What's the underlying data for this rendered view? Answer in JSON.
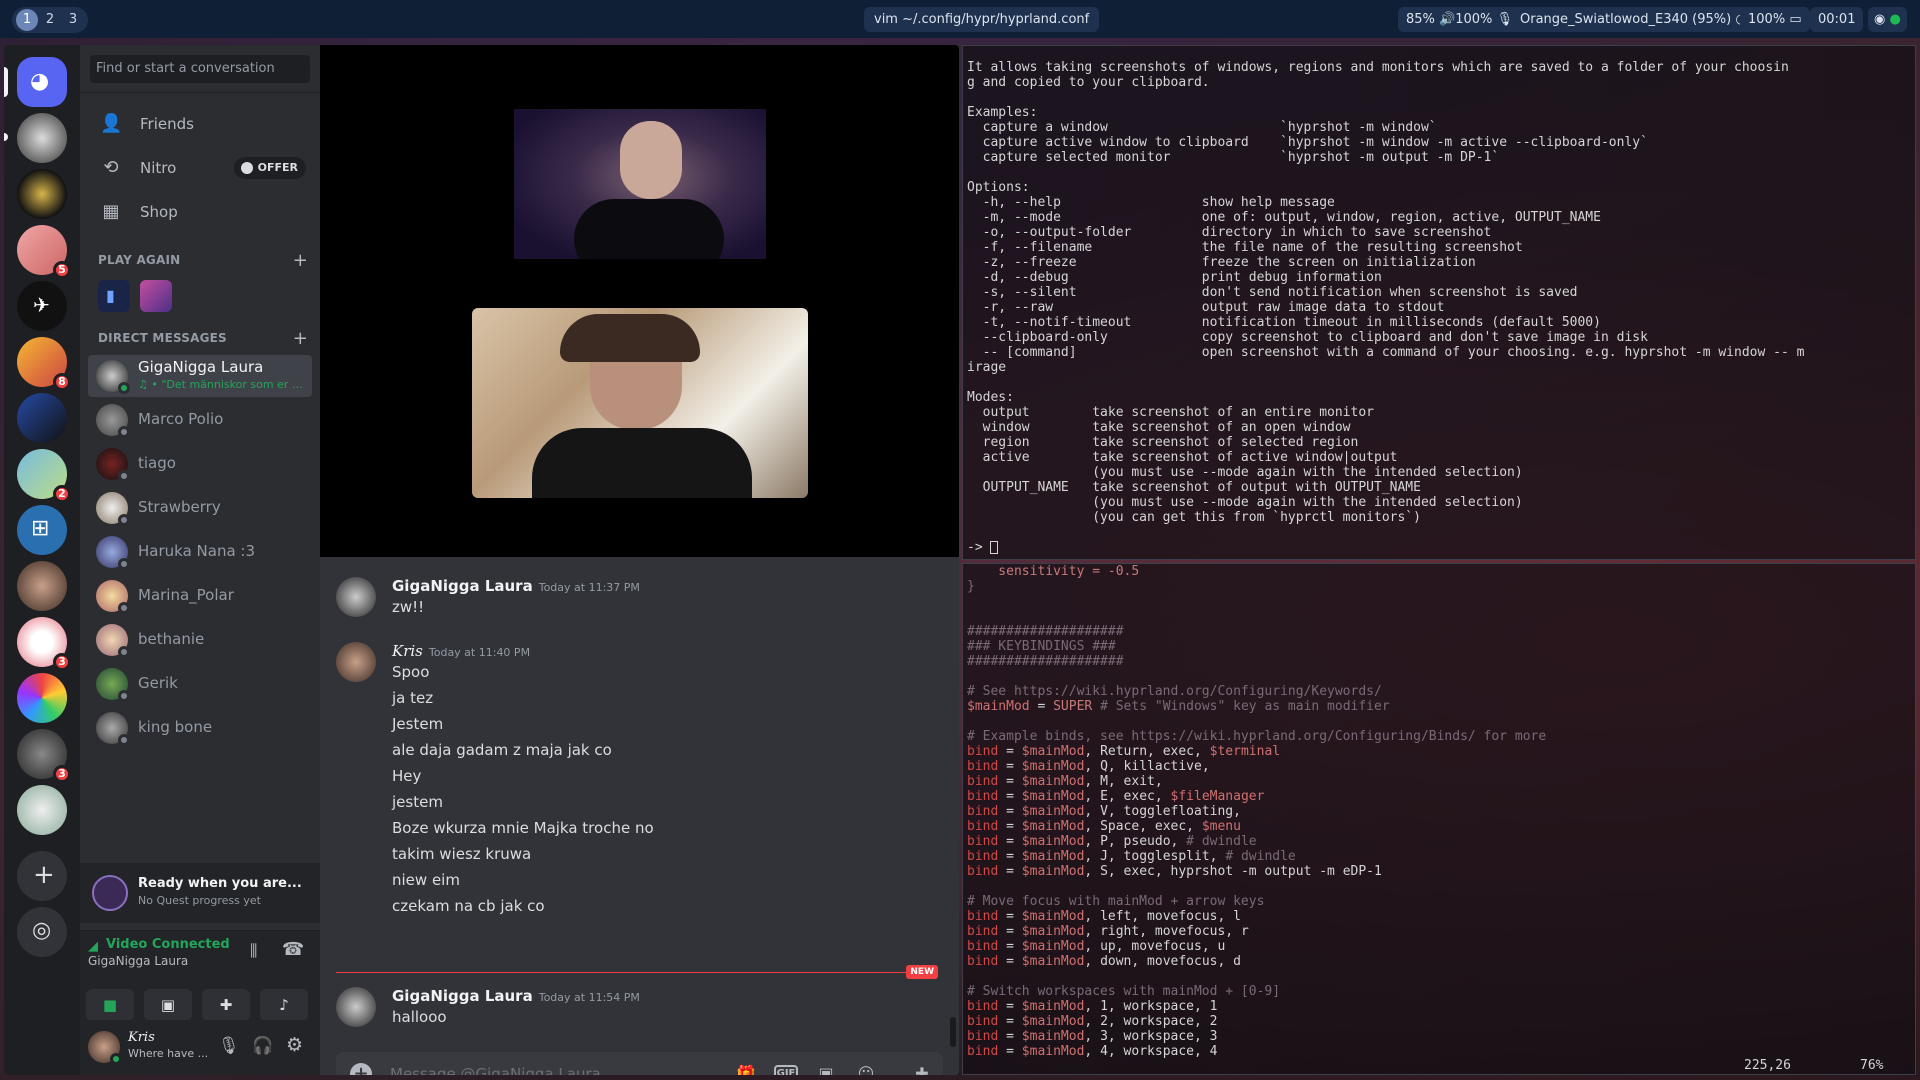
{
  "topbar": {
    "workspaces": [
      "1",
      "2",
      "3"
    ],
    "window_title": "vim ~/.config/hypr/hyprland.conf",
    "brightness": "85%",
    "volume": "100%",
    "wifi": "Orange_Swiatlowod_E340 (95%)",
    "battery": "100%",
    "clock": "00:01"
  },
  "discord": {
    "search_placeholder": "Find or start a conversation",
    "nav": {
      "friends": "Friends",
      "nitro": "Nitro",
      "nitro_offer": "OFFER",
      "shop": "Shop"
    },
    "play_again_header": "PLAY AGAIN",
    "dm_header": "DIRECT MESSAGES",
    "server_badges": [
      "5",
      "8",
      "2",
      "3",
      "3"
    ],
    "dms": [
      {
        "name": "GigaNigga Laura",
        "sub": "♫ • \"Det människor som er so..."
      },
      {
        "name": "Marco Polio"
      },
      {
        "name": "tiago"
      },
      {
        "name": "Strawberry"
      },
      {
        "name": "Haruka Nana :3"
      },
      {
        "name": "Marina_Polar"
      },
      {
        "name": "bethanie"
      },
      {
        "name": "Gerik"
      },
      {
        "name": "king bone"
      }
    ],
    "quest": {
      "title": "Ready when you are...",
      "sub": "No Quest progress yet"
    },
    "voice": {
      "status": "Video Connected",
      "channel": "GigaNigga Laura"
    },
    "user": {
      "name": "Kris",
      "status": "Where have ..."
    },
    "messages": [
      {
        "author": "GigaNigga Laura",
        "time": "Today at 11:37 PM",
        "lines": [
          "zw!!"
        ]
      },
      {
        "author": "Kris",
        "time": "Today at 11:40 PM",
        "lines": [
          "Spoo",
          "ja tez",
          "Jestem",
          "ale daja gadam z maja jak co",
          "Hey",
          "jestem",
          "Boze wkurza mnie Majka troche no",
          "takim wiesz kruwa",
          "niew eim",
          "czekam na cb jak co"
        ]
      },
      {
        "author": "GigaNigga Laura",
        "time": "Today at 11:54 PM",
        "lines": [
          "hallooo"
        ]
      }
    ],
    "new_label": "NEW",
    "composer_placeholder": "Message @GigaNigga Laura",
    "composer_gif": "GIF"
  },
  "term1": {
    "lines": [
      "It allows taking screenshots of windows, regions and monitors which are saved to a folder of your choosin",
      "g and copied to your clipboard.",
      "",
      "Examples:",
      "  capture a window                      `hyprshot -m window`",
      "  capture active window to clipboard    `hyprshot -m window -m active --clipboard-only`",
      "  capture selected monitor              `hyprshot -m output -m DP-1`",
      "",
      "Options:",
      "  -h, --help                  show help message",
      "  -m, --mode                  one of: output, window, region, active, OUTPUT_NAME",
      "  -o, --output-folder         directory in which to save screenshot",
      "  -f, --filename              the file name of the resulting screenshot",
      "  -z, --freeze                freeze the screen on initialization",
      "  -d, --debug                 print debug information",
      "  -s, --silent                don't send notification when screenshot is saved",
      "  -r, --raw                   output raw image data to stdout",
      "  -t, --notif-timeout         notification timeout in milliseconds (default 5000)",
      "  --clipboard-only            copy screenshot to clipboard and don't save image in disk",
      "  -- [command]                open screenshot with a command of your choosing. e.g. hyprshot -m window -- m",
      "irage",
      "",
      "Modes:",
      "  output        take screenshot of an entire monitor",
      "  window        take screenshot of an open window",
      "  region        take screenshot of selected region",
      "  active        take screenshot of active window|output",
      "                (you must use --mode again with the intended selection)",
      "  OUTPUT_NAME   take screenshot of output with OUTPUT_NAME",
      "                (you must use --mode again with the intended selection)",
      "                (you can get this from `hyprctl monitors`)",
      "",
      "-> "
    ]
  },
  "term2": {
    "lines": [
      "    sensitivity = -0.5",
      "}",
      "",
      "",
      "####################",
      "### KEYBINDINGS ###",
      "####################",
      "",
      "# See https://wiki.hyprland.org/Configuring/Keywords/",
      "$mainMod = SUPER # Sets \"Windows\" key as main modifier",
      "",
      "# Example binds, see https://wiki.hyprland.org/Configuring/Binds/ for more",
      "bind = $mainMod, Return, exec, $terminal",
      "bind = $mainMod, Q, killactive,",
      "bind = $mainMod, M, exit,",
      "bind = $mainMod, E, exec, $fileManager",
      "bind = $mainMod, V, togglefloating,",
      "bind = $mainMod, Space, exec, $menu",
      "bind = $mainMod, P, pseudo, # dwindle",
      "bind = $mainMod, J, togglesplit, # dwindle",
      "bind = $mainMod, S, exec, hyprshot -m output -m eDP-1",
      "",
      "# Move focus with mainMod + arrow keys",
      "bind = $mainMod, left, movefocus, l",
      "bind = $mainMod, right, movefocus, r",
      "bind = $mainMod, up, movefocus, u",
      "bind = $mainMod, down, movefocus, d",
      "",
      "# Switch workspaces with mainMod + [0-9]",
      "bind = $mainMod, 1, workspace, 1",
      "bind = $mainMod, 2, workspace, 2",
      "bind = $mainMod, 3, workspace, 3",
      "bind = $mainMod, 4, workspace, 4"
    ],
    "cursor_pos": "225,26",
    "percent": "76%"
  },
  "colors": {
    "discord_green": "#23a55a",
    "badge_red": "#f23f42",
    "blurple": "#5865f2",
    "term_keyword": "#d04848"
  }
}
